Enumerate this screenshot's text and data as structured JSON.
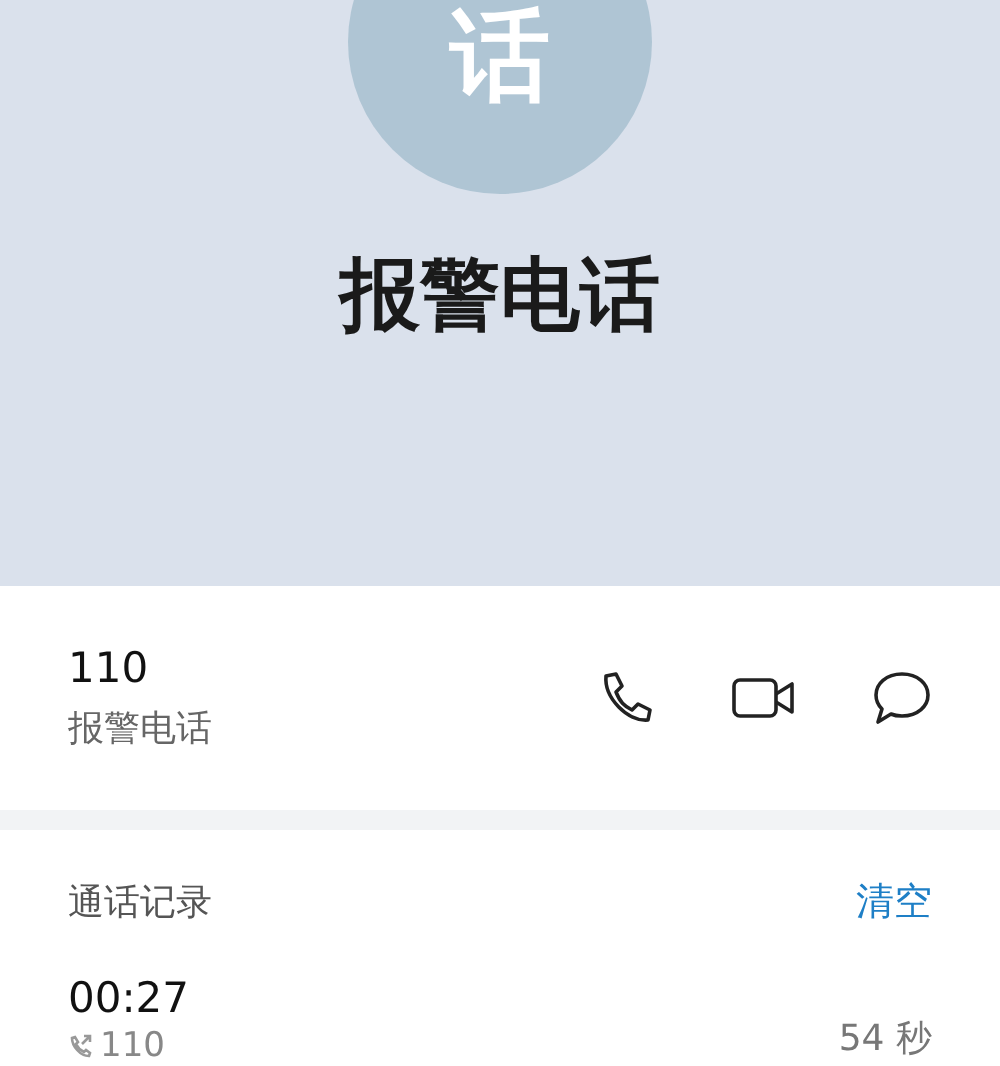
{
  "avatar": {
    "letter": "话"
  },
  "contact_name": "报警电话",
  "number": {
    "value": "110",
    "label": "报警电话"
  },
  "actions": [
    {
      "kind": "call"
    },
    {
      "kind": "video"
    },
    {
      "kind": "message"
    }
  ],
  "call_log": {
    "title": "通话记录",
    "clear": "清空",
    "entries": [
      {
        "time": "00:27",
        "number": "110",
        "duration": "54 秒"
      }
    ]
  }
}
